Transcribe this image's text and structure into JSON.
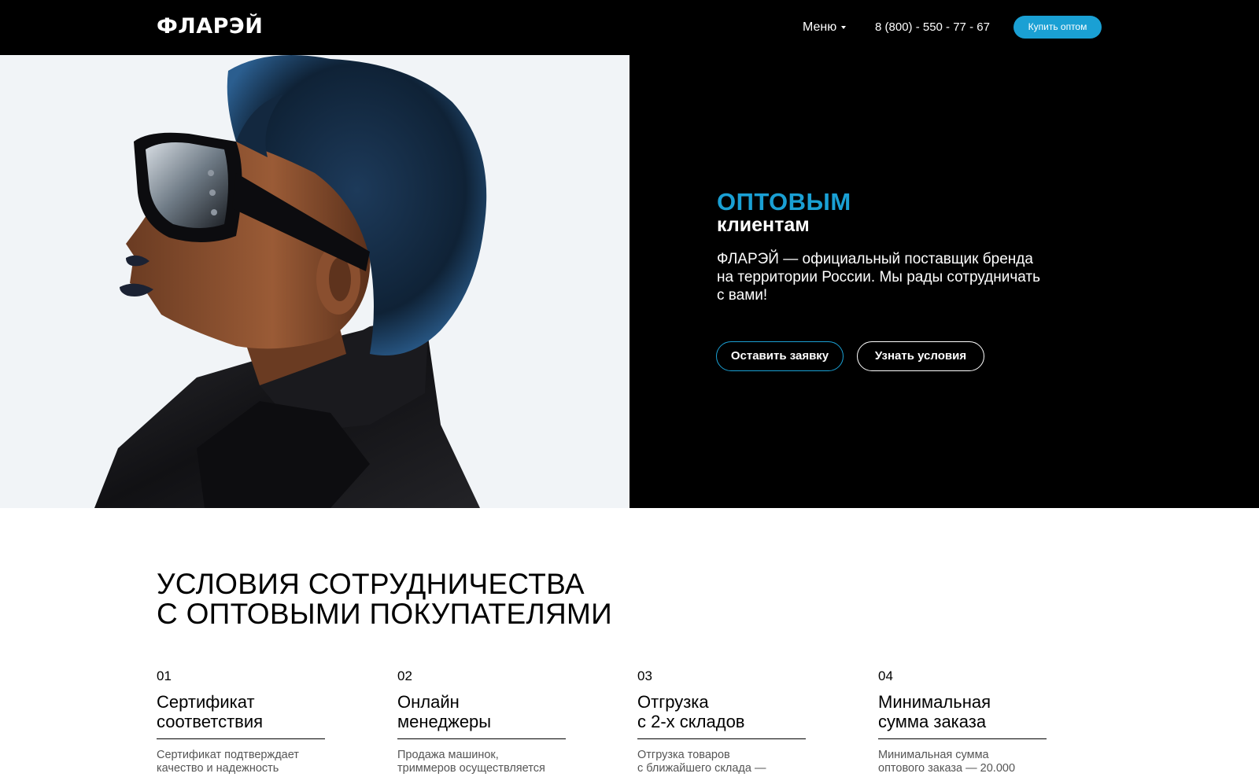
{
  "colors": {
    "accent": "#1aa0d4",
    "header_bg": "#000000",
    "hero_bg": "#000000"
  },
  "header": {
    "logo": "ФЛАРЭЙ",
    "menu_label": "Меню",
    "phone": "8 (800) - 550 - 77 - 67",
    "buy_button": "Купить оптом"
  },
  "hero": {
    "title_accent": "ОПТОВЫМ",
    "title": "клиентам",
    "description": "ФЛАРЭЙ — официальный поставщик бренда на территории России. Мы рады сотрудничать с вами!",
    "primary_button": "Оставить заявку",
    "secondary_button": "Узнать условия"
  },
  "terms": {
    "title_line1": "УСЛОВИЯ СОТРУДНИЧЕСТВА",
    "title_line2": "С ОПТОВЫМИ ПОКУПАТЕЛЯМИ",
    "cards": [
      {
        "num": "01",
        "title_line1": "Сертификат",
        "title_line2": "соответствия",
        "text_line1": "Сертификат подтверждает",
        "text_line2": "качество и надежность"
      },
      {
        "num": "02",
        "title_line1": "Онлайн",
        "title_line2": "менеджеры",
        "text_line1": "Продажа машинок,",
        "text_line2": "триммеров осуществляется"
      },
      {
        "num": "03",
        "title_line1": "Отгрузка",
        "title_line2": "с 2-х складов",
        "text_line1": "Отгрузка товаров",
        "text_line2": "с ближайшего склада —"
      },
      {
        "num": "04",
        "title_line1": "Минимальная",
        "title_line2": "сумма заказа",
        "text_line1": "Минимальная сумма",
        "text_line2": "оптового заказа — 20.000"
      }
    ]
  }
}
